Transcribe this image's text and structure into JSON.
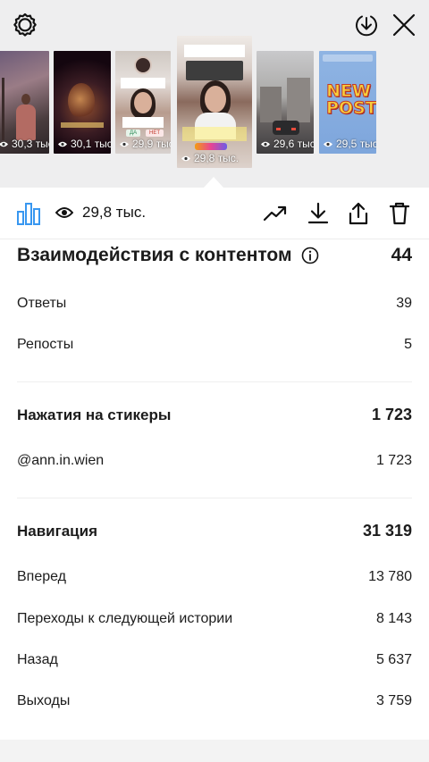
{
  "colors": {
    "accent": "#3897f0",
    "viewer_bg": "#eeeeef",
    "text": "#111111"
  },
  "top_bar": {
    "settings_icon": "gear-icon",
    "download_icon": "download-circle-icon",
    "close_icon": "close-icon"
  },
  "stories": [
    {
      "views": "30,3 тыс."
    },
    {
      "views": "30,1 тыс."
    },
    {
      "views": "29,9 тыс."
    },
    {
      "views": "29,8 тыс.",
      "selected": true
    },
    {
      "views": "29,6 тыс."
    },
    {
      "views": "29,5 тыс."
    }
  ],
  "story_texts": {
    "thumb3_poll_yes": "ДА",
    "thumb3_poll_no": "НЕТ",
    "thumb6_headline": "NEW POST"
  },
  "toolbar": {
    "views_count": "29,8 тыс.",
    "icons": [
      "bar-chart-icon",
      "eye-icon",
      "trending-up-icon",
      "download-icon",
      "share-icon",
      "trash-icon"
    ]
  },
  "stats": {
    "interactions": {
      "title": "Взаимодействия с контентом",
      "total": "44",
      "rows": [
        {
          "label": "Ответы",
          "value": "39"
        },
        {
          "label": "Репосты",
          "value": "5"
        }
      ]
    },
    "sticker_taps": {
      "title": "Нажатия на стикеры",
      "total": "1 723",
      "rows": [
        {
          "label": "@ann.in.wien",
          "value": "1 723"
        }
      ]
    },
    "navigation": {
      "title": "Навигация",
      "total": "31 319",
      "rows": [
        {
          "label": "Вперед",
          "value": "13 780"
        },
        {
          "label": "Переходы к следующей истории",
          "value": "8 143"
        },
        {
          "label": "Назад",
          "value": "5 637"
        },
        {
          "label": "Выходы",
          "value": "3 759"
        }
      ]
    }
  }
}
